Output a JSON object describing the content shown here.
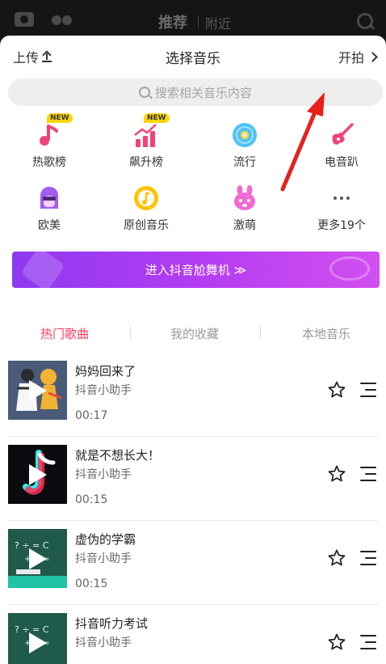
{
  "topbar": {
    "tab_recommend": "推荐",
    "tab_nearby": "附近"
  },
  "header": {
    "upload_label": "上传",
    "title": "选择音乐",
    "start_label": "开拍"
  },
  "search": {
    "placeholder": "搜索相关音乐内容"
  },
  "categories": [
    {
      "label": "热歌榜",
      "icon": "music-note-icon",
      "badge": "NEW"
    },
    {
      "label": "飙升榜",
      "icon": "trending-chart-icon",
      "badge": "NEW"
    },
    {
      "label": "流行",
      "icon": "vinyl-disc-icon"
    },
    {
      "label": "电音趴",
      "icon": "electric-guitar-icon"
    },
    {
      "label": "欧美",
      "icon": "sunglasses-face-icon"
    },
    {
      "label": "原创音乐",
      "icon": "record-note-icon"
    },
    {
      "label": "激萌",
      "icon": "cute-bunny-icon"
    },
    {
      "label": "更多19个",
      "icon": "more-dots-icon"
    }
  ],
  "banner": {
    "label": "进入抖音尬舞机 ≫"
  },
  "tabs": [
    {
      "label": "热门歌曲",
      "active": true
    },
    {
      "label": "我的收藏",
      "active": false
    },
    {
      "label": "本地音乐",
      "active": false
    }
  ],
  "songs": [
    {
      "title": "妈妈回来了",
      "artist": "抖音小助手",
      "duration": "00:17"
    },
    {
      "title": "就是不想长大！",
      "artist": "抖音小助手",
      "duration": "00:15"
    },
    {
      "title": "虚伪的学霸",
      "artist": "抖音小助手",
      "duration": "00:15"
    },
    {
      "title": "抖音听力考试",
      "artist": "抖音小助手",
      "duration": ""
    }
  ],
  "colors": {
    "accent": "#ff3b5c",
    "banner_start": "#8e3af0",
    "banner_end": "#d24ff0",
    "annotation": "#e8201c"
  }
}
